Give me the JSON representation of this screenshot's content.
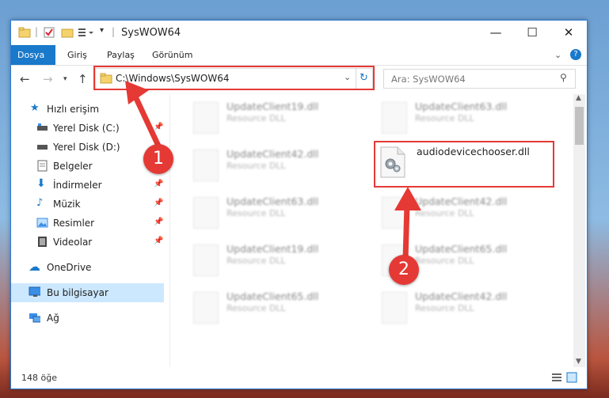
{
  "window": {
    "title": "SysWOW64",
    "minimize": "—",
    "maximize": "☐",
    "close": "✕"
  },
  "ribbon": {
    "tabs": [
      "Dosya",
      "Giriş",
      "Paylaş",
      "Görünüm"
    ],
    "active_tab": "Dosya",
    "help": "?"
  },
  "nav": {
    "address": "C:\\Windows\\SysWOW64",
    "search_placeholder": "Ara: SysWOW64"
  },
  "sidebar": {
    "items": [
      {
        "label": "Hızlı erişim",
        "icon": "star-icon"
      },
      {
        "label": "Yerel Disk (C:)",
        "icon": "drive-icon"
      },
      {
        "label": "Yerel Disk (D:)",
        "icon": "drive-icon"
      },
      {
        "label": "Belgeler",
        "icon": "document-icon"
      },
      {
        "label": "İndirmeler",
        "icon": "download-icon"
      },
      {
        "label": "Müzik",
        "icon": "music-icon"
      },
      {
        "label": "Resimler",
        "icon": "image-icon"
      },
      {
        "label": "Videolar",
        "icon": "video-icon"
      },
      {
        "label": "OneDrive",
        "icon": "cloud-icon"
      },
      {
        "label": "Bu bilgisayar",
        "icon": "computer-icon"
      },
      {
        "label": "Ağ",
        "icon": "network-icon"
      }
    ]
  },
  "files": [
    {
      "name": "UpdateClient19.dll",
      "type": "Resource DLL"
    },
    {
      "name": "UpdateClient63.dll",
      "type": "Resource DLL"
    },
    {
      "name": "UpdateClient42.dll",
      "type": "Resource DLL"
    },
    {
      "name": "audiodevicechooser.dll",
      "type": ""
    },
    {
      "name": "UpdateClient63.dll",
      "type": "Resource DLL"
    },
    {
      "name": "UpdateClient42.dll",
      "type": "Resource DLL"
    },
    {
      "name": "UpdateClient19.dll",
      "type": "Resource DLL"
    },
    {
      "name": "UpdateClient65.dll",
      "type": "Resource DLL"
    },
    {
      "name": "UpdateClient65.dll",
      "type": "Resource DLL"
    },
    {
      "name": "UpdateClient42.dll",
      "type": "Resource DLL"
    }
  ],
  "status": {
    "count": "148 öğe"
  },
  "annotations": {
    "step1": "1",
    "step2": "2"
  },
  "colors": {
    "accent": "#1979ca",
    "highlight": "#e53935"
  }
}
